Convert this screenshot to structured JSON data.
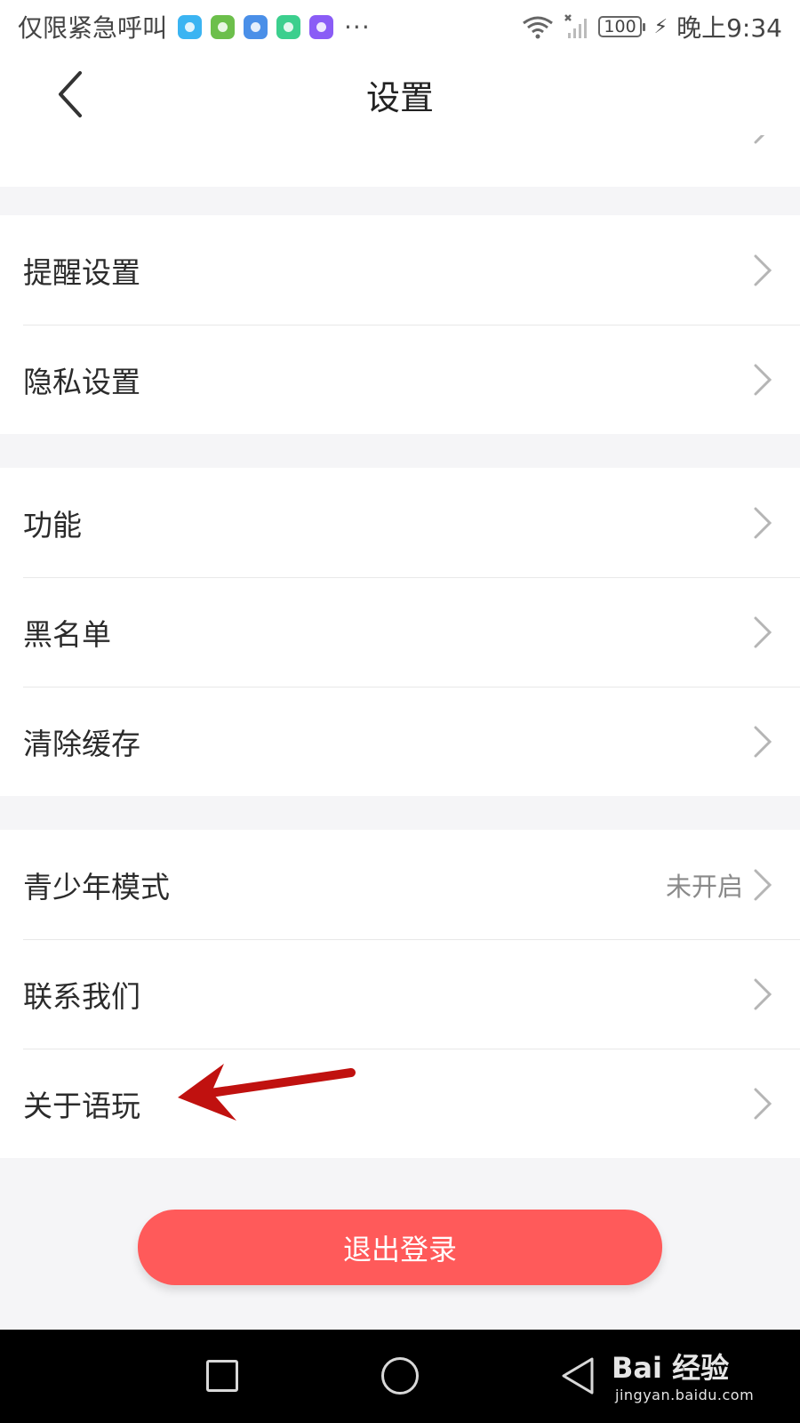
{
  "status_bar": {
    "carrier": "仅限紧急呼叫",
    "more": "···",
    "battery": "100",
    "time": "晚上9:34",
    "app_icon_colors": [
      "#3bb4f2",
      "#6cbf4b",
      "#4a8fe8",
      "#3ccf8e",
      "#8a5cf6"
    ]
  },
  "header": {
    "title": "设置"
  },
  "sections": [
    {
      "items": [
        {
          "label": "提醒设置"
        },
        {
          "label": "隐私设置"
        }
      ]
    },
    {
      "items": [
        {
          "label": "功能"
        },
        {
          "label": "黑名单"
        },
        {
          "label": "清除缓存"
        }
      ]
    },
    {
      "items": [
        {
          "label": "青少年模式",
          "value": "未开启"
        },
        {
          "label": "联系我们"
        },
        {
          "label": "关于语玩"
        }
      ]
    }
  ],
  "logout": {
    "label": "退出登录",
    "color": "#ff5a5a"
  },
  "annotation": {
    "arrow_color": "#c0110f"
  },
  "watermark": {
    "brand": "Bai 经验",
    "url": "jingyan.baidu.com"
  }
}
